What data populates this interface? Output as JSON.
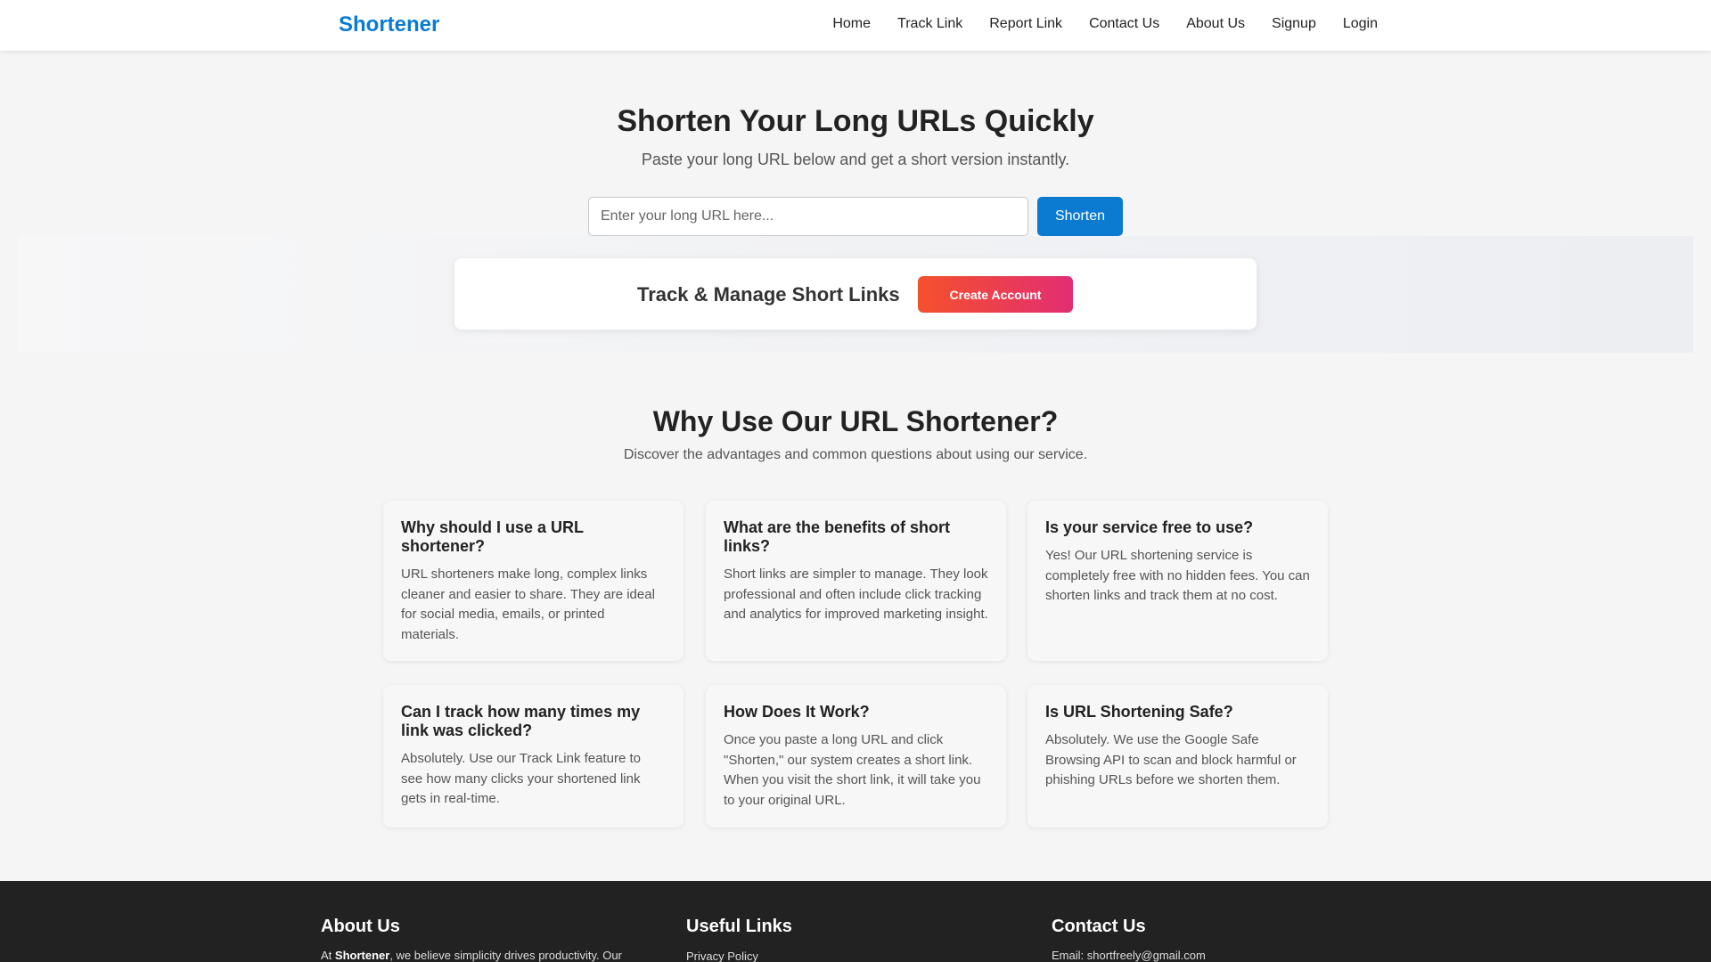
{
  "navbar": {
    "brand": "Shortener",
    "links": [
      "Home",
      "Track Link",
      "Report Link",
      "Contact Us",
      "About Us",
      "Signup",
      "Login"
    ]
  },
  "hero": {
    "title": "Shorten Your Long URLs Quickly",
    "subtitle": "Paste your long URL below and get a short version instantly.",
    "input_placeholder": "Enter your long URL here...",
    "input_value": "",
    "shorten_label": "Shorten"
  },
  "promo": {
    "text": "Track & Manage Short Links",
    "button_label": "Create Account"
  },
  "features": {
    "title": "Why Use Our URL Shortener?",
    "subtitle": "Discover the advantages and common questions about using our service.",
    "cards": [
      {
        "title": "Why should I use a URL shortener?",
        "body": "URL shorteners make long, complex links cleaner and easier to share. They are ideal for social media, emails, or printed materials."
      },
      {
        "title": "What are the benefits of short links?",
        "body": "Short links are simpler to manage. They look professional and often include click tracking and analytics for improved marketing insight."
      },
      {
        "title": "Is your service free to use?",
        "body": "Yes! Our URL shortening service is completely free with no hidden fees. You can shorten links and track them at no cost."
      },
      {
        "title": "Can I track how many times my link was clicked?",
        "body": "Absolutely. Use our Track Link feature to see how many clicks your shortened link gets in real-time."
      },
      {
        "title": "How Does It Work?",
        "body": "Once you paste a long URL and click \"Shorten,\" our system creates a short link. When you visit the short link, it will take you to your original URL."
      },
      {
        "title": "Is URL Shortening Safe?",
        "body": "Absolutely. We use the Google Safe Browsing API to scan and block harmful or phishing URLs before we shorten them."
      }
    ]
  },
  "footer": {
    "about_heading": "About Us",
    "about_prefix": "At ",
    "about_brand": "Shortener",
    "about_suffix": ", we believe simplicity drives productivity. Our",
    "links_heading": "Useful Links",
    "links": [
      "Privacy Policy"
    ],
    "contact_heading": "Contact Us",
    "contact_email": "Email: shortfreely@gmail.com"
  },
  "colors": {
    "brand": "#0a7bd1",
    "shorten_button": "#0a7bd1",
    "create_account_gradient": [
      "#f4512c",
      "#e22d73"
    ],
    "footer_bg": "#222222"
  }
}
